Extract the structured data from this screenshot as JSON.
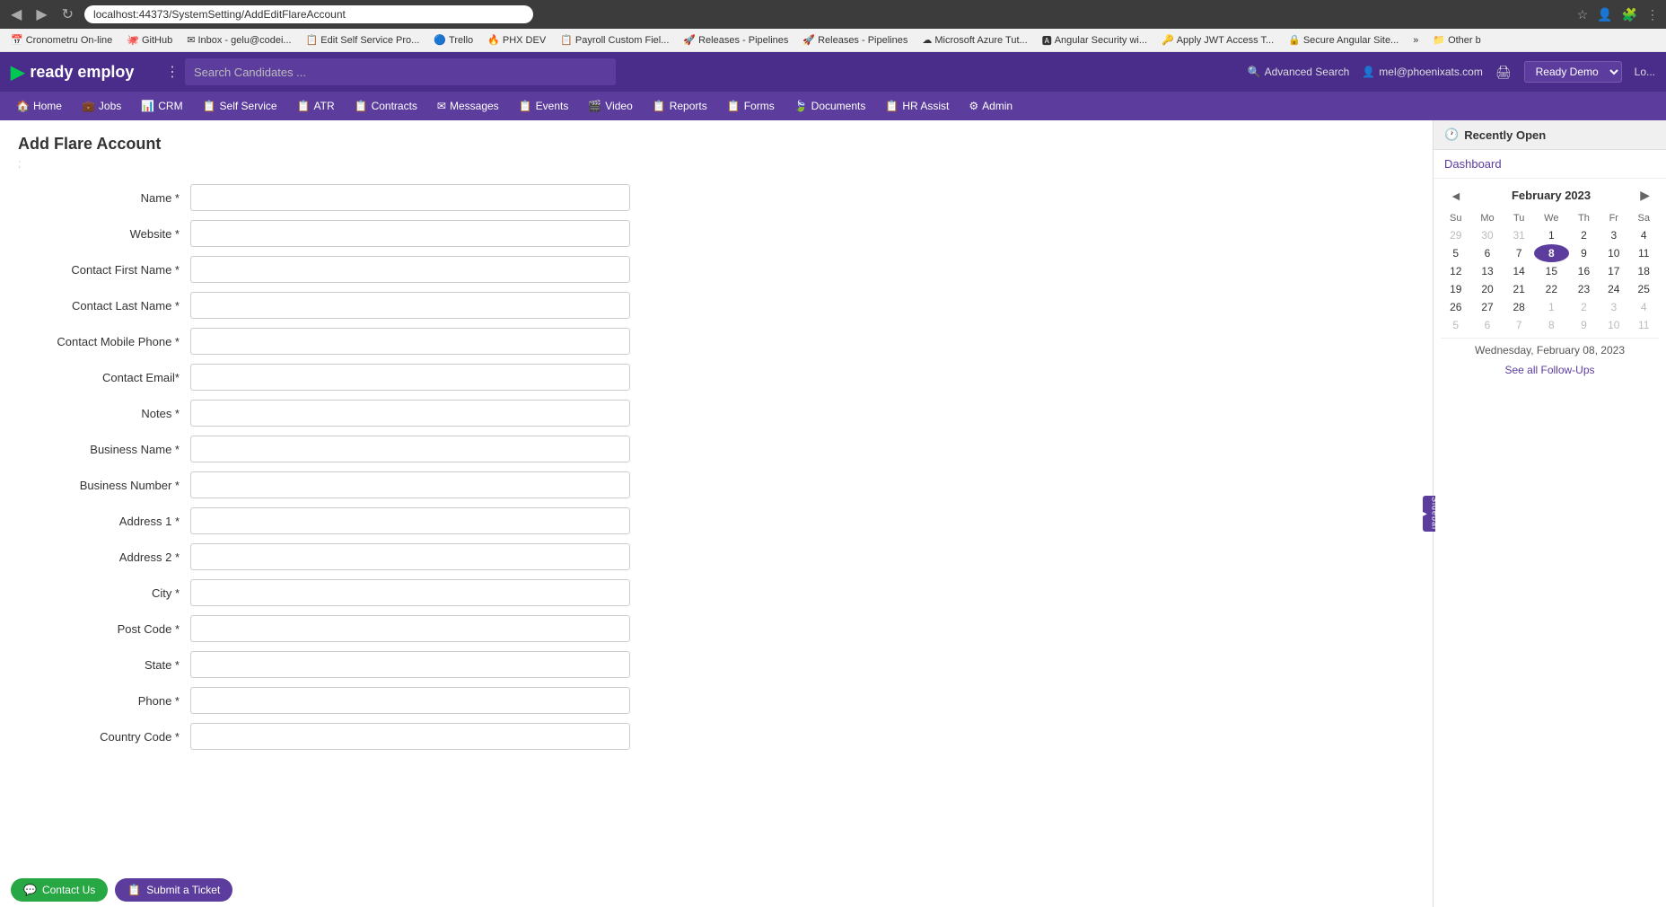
{
  "browser": {
    "url": "localhost:44373/SystemSetting/AddEditFlareAccount",
    "nav_back": "◀",
    "nav_forward": "▶",
    "nav_reload": "↻"
  },
  "bookmarks": [
    {
      "label": "Cronometru On-line",
      "icon": "📅"
    },
    {
      "label": "GitHub",
      "icon": "🐙"
    },
    {
      "label": "Inbox - gelu@codei...",
      "icon": "✉"
    },
    {
      "label": "Edit Self Service Pro...",
      "icon": "📋"
    },
    {
      "label": "Trello",
      "icon": "🔵"
    },
    {
      "label": "PHX DEV",
      "icon": "🔥"
    },
    {
      "label": "Payroll Custom Fiel...",
      "icon": "📋"
    },
    {
      "label": "Releases - Pipelines",
      "icon": "🚀"
    },
    {
      "label": "Releases - Pipelines",
      "icon": "🚀"
    },
    {
      "label": "Microsoft Azure Tut...",
      "icon": "☁"
    },
    {
      "label": "Angular Security wi...",
      "icon": "🅰"
    },
    {
      "label": "Apply JWT Access T...",
      "icon": "🔑"
    },
    {
      "label": "Secure Angular Site...",
      "icon": "🔒"
    },
    {
      "label": "»",
      "icon": ""
    },
    {
      "label": "Other b",
      "icon": "📁"
    }
  ],
  "header": {
    "logo_text": "ready employ",
    "logo_icon": "▶",
    "search_placeholder": "Search Candidates ...",
    "adv_search_label": "Advanced Search",
    "user_icon": "👤",
    "user_email": "mel@phoenixats.com",
    "printer_icon": "🖨",
    "demo_label": "Ready Demo",
    "login_label": "Lo..."
  },
  "nav": {
    "items": [
      {
        "label": "Home",
        "icon": "🏠"
      },
      {
        "label": "Jobs",
        "icon": "💼"
      },
      {
        "label": "CRM",
        "icon": "📊"
      },
      {
        "label": "Self Service",
        "icon": "📋"
      },
      {
        "label": "ATR",
        "icon": "📋"
      },
      {
        "label": "Contracts",
        "icon": "📋"
      },
      {
        "label": "Messages",
        "icon": "✉"
      },
      {
        "label": "Events",
        "icon": "📋"
      },
      {
        "label": "Video",
        "icon": "🎬"
      },
      {
        "label": "Reports",
        "icon": "📋"
      },
      {
        "label": "Forms",
        "icon": "📋"
      },
      {
        "label": "Documents",
        "icon": "🍃"
      },
      {
        "label": "HR Assist",
        "icon": "📋"
      },
      {
        "label": "Admin",
        "icon": "⚙"
      }
    ]
  },
  "page": {
    "title": "Add Flare Account",
    "separator": ";"
  },
  "form": {
    "fields": [
      {
        "label": "Name *",
        "id": "name",
        "placeholder": ""
      },
      {
        "label": "Website *",
        "id": "website",
        "placeholder": ""
      },
      {
        "label": "Contact First Name *",
        "id": "contact_first_name",
        "placeholder": ""
      },
      {
        "label": "Contact Last Name *",
        "id": "contact_last_name",
        "placeholder": ""
      },
      {
        "label": "Contact Mobile Phone *",
        "id": "contact_mobile_phone",
        "placeholder": ""
      },
      {
        "label": "Contact Email*",
        "id": "contact_email",
        "placeholder": ""
      },
      {
        "label": "Notes *",
        "id": "notes",
        "placeholder": ""
      },
      {
        "label": "Business Name *",
        "id": "business_name",
        "placeholder": ""
      },
      {
        "label": "Business Number *",
        "id": "business_number",
        "placeholder": ""
      },
      {
        "label": "Address 1 *",
        "id": "address1",
        "placeholder": ""
      },
      {
        "label": "Address 2 *",
        "id": "address2",
        "placeholder": ""
      },
      {
        "label": "City *",
        "id": "city",
        "placeholder": ""
      },
      {
        "label": "Post Code *",
        "id": "post_code",
        "placeholder": ""
      },
      {
        "label": "State *",
        "id": "state",
        "placeholder": ""
      },
      {
        "label": "Phone *",
        "id": "phone",
        "placeholder": ""
      },
      {
        "label": "Country Code *",
        "id": "country_code",
        "placeholder": ""
      }
    ]
  },
  "sidebar": {
    "toggle_label": "Sidebar",
    "recently_open_title": "Recently Open",
    "recently_open_icon": "🕐",
    "links": [
      {
        "label": "Dashboard"
      }
    ],
    "calendar": {
      "prev_btn": "◄",
      "month_year": "February 2023",
      "days_header": [
        "Su",
        "Mo",
        "Tu",
        "We",
        "Th",
        "Fr",
        "Sa"
      ],
      "weeks": [
        [
          {
            "day": "29",
            "other": true
          },
          {
            "day": "30",
            "other": true
          },
          {
            "day": "31",
            "other": true
          },
          {
            "day": "1"
          },
          {
            "day": "2"
          },
          {
            "day": "3"
          },
          {
            "day": "4"
          }
        ],
        [
          {
            "day": "5"
          },
          {
            "day": "6"
          },
          {
            "day": "7"
          },
          {
            "day": "8",
            "today": true
          },
          {
            "day": "9"
          },
          {
            "day": "10"
          },
          {
            "day": "11"
          }
        ],
        [
          {
            "day": "12"
          },
          {
            "day": "13"
          },
          {
            "day": "14"
          },
          {
            "day": "15"
          },
          {
            "day": "16"
          },
          {
            "day": "17"
          },
          {
            "day": "18"
          }
        ],
        [
          {
            "day": "19"
          },
          {
            "day": "20"
          },
          {
            "day": "21"
          },
          {
            "day": "22"
          },
          {
            "day": "23"
          },
          {
            "day": "24"
          },
          {
            "day": "25"
          }
        ],
        [
          {
            "day": "26"
          },
          {
            "day": "27"
          },
          {
            "day": "28"
          },
          {
            "day": "1",
            "other": true
          },
          {
            "day": "2",
            "other": true
          },
          {
            "day": "3",
            "other": true
          },
          {
            "day": "4",
            "other": true
          }
        ],
        [
          {
            "day": "5",
            "other": true
          },
          {
            "day": "6",
            "other": true
          },
          {
            "day": "7",
            "other": true
          },
          {
            "day": "8",
            "other": true
          },
          {
            "day": "9",
            "other": true
          },
          {
            "day": "10",
            "other": true
          },
          {
            "day": "11",
            "other": true
          }
        ]
      ],
      "date_label": "Wednesday, February 08, 2023",
      "see_all_label": "See all Follow-Ups"
    }
  },
  "footer": {
    "contact_btn": "Contact Us",
    "ticket_btn": "Submit a Ticket",
    "contact_icon": "💬",
    "ticket_icon": "📋"
  }
}
